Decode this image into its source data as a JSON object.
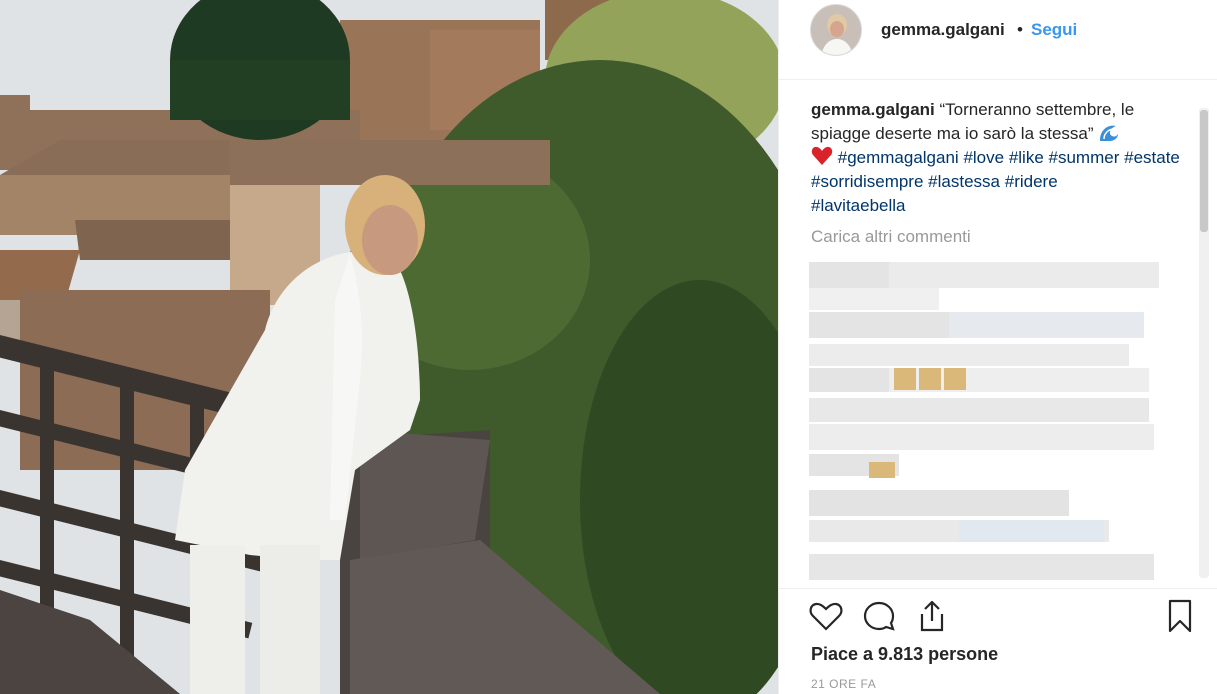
{
  "post": {
    "username": "gemma.galgani",
    "separator": "•",
    "follow_label": "Segui",
    "caption_user": "gemma.galgani",
    "caption_text": "“Torneranno settembre, le spiagge deserte ma io sarò la stessa”",
    "hashtags": [
      "#gemmagalgani",
      "#love",
      "#like",
      "#summer",
      "#estate",
      "#sorridisempre",
      "#lastessa",
      "#ridere",
      "#lavitaebella"
    ],
    "load_more_label": "Carica altri commenti",
    "likes_label": "Piace a 9.813 persone",
    "time_label": "21 ORE FA"
  },
  "icons": {
    "like": "heart-icon",
    "comment": "comment-icon",
    "share": "share-icon",
    "save": "bookmark-icon",
    "wave_emoji": "wave-emoji-icon",
    "heart_emoji": "red-heart-emoji-icon"
  },
  "colors": {
    "link_blue": "#3897f0",
    "hashtag": "#003569",
    "muted": "#999999"
  }
}
